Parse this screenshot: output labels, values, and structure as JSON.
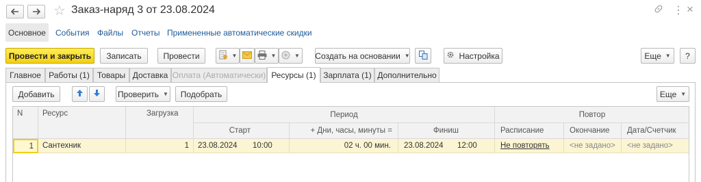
{
  "window": {
    "title": "Заказ-наряд 3 от 23.08.2024",
    "back_icon": "arrow-left-icon",
    "forward_icon": "arrow-right-icon",
    "favorite_icon": "star-icon",
    "link_icon": "link-icon",
    "more_icon": "vertical-dots-icon",
    "close_icon": "close-icon"
  },
  "nav": {
    "items": [
      "Основное",
      "События",
      "Файлы",
      "Отчеты",
      "Примененные автоматические скидки"
    ],
    "active": "Основное"
  },
  "toolbar": {
    "post_close": "Провести и закрыть",
    "save": "Записать",
    "post": "Провести",
    "create_based": "Создать на основании",
    "settings": "Настройка",
    "more": "Еще",
    "help": "?"
  },
  "tabs": [
    {
      "label": "Главное",
      "state": "normal"
    },
    {
      "label": "Работы (1)",
      "state": "normal"
    },
    {
      "label": "Товары",
      "state": "normal"
    },
    {
      "label": "Доставка",
      "state": "normal"
    },
    {
      "label": "Оплата (Автоматически)",
      "state": "disabled"
    },
    {
      "label": "Ресурсы (1)",
      "state": "active"
    },
    {
      "label": "Зарплата (1)",
      "state": "normal"
    },
    {
      "label": "Дополнительно",
      "state": "normal"
    }
  ],
  "table_toolbar": {
    "add": "Добавить",
    "check": "Проверить",
    "pick": "Подобрать",
    "more": "Еще"
  },
  "table": {
    "headers": {
      "n": "N",
      "resource": "Ресурс",
      "load": "Загрузка",
      "period": "Период",
      "repeat": "Повтор",
      "start": "Старт",
      "duration": "+ Дни, часы, минуты =",
      "finish": "Финиш",
      "schedule": "Расписание",
      "end": "Окончание",
      "date_counter": "Дата/Счетчик"
    },
    "rows": [
      {
        "n": "1",
        "resource": "Сантехник",
        "load": "1",
        "start_date": "23.08.2024",
        "start_time": "10:00",
        "duration": "02 ч. 00 мин.",
        "finish_date": "23.08.2024",
        "finish_time": "12:00",
        "schedule": "Не повторять",
        "end": "<не задано>",
        "date_counter": "<не задано>"
      }
    ]
  },
  "colors": {
    "primary": "#f2cf17",
    "link": "#1d5a99",
    "row_highlight": "#fbf5d3",
    "arrow_blue": "#2f7fd8"
  }
}
